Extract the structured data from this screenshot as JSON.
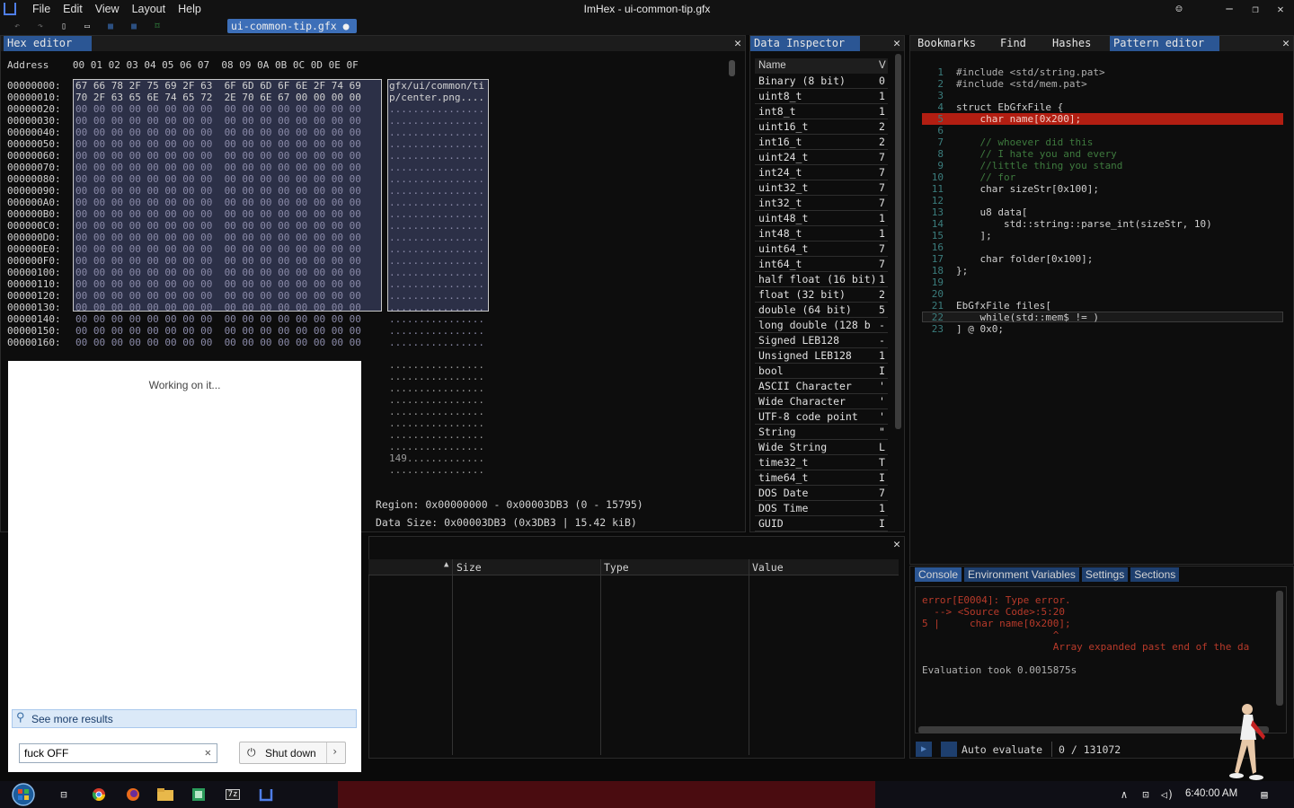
{
  "window": {
    "title": "ImHex - ui-common-tip.gfx",
    "menu": [
      "File",
      "Edit",
      "View",
      "Layout",
      "Help"
    ],
    "file_tab": "ui-common-tip.gfx ●"
  },
  "hex_editor": {
    "tab": "Hex editor",
    "header": "Address    00 01 02 03 04 05 06 07  08 09 0A 0B 0C 0D 0E 0F",
    "rows": [
      {
        "addr": "00000000:",
        "bytes": "67 66 78 2F 75 69 2F 63  6F 6D 6D 6F 6E 2F 74 69",
        "ascii": "gfx/ui/common/ti"
      },
      {
        "addr": "00000010:",
        "bytes": "70 2F 63 65 6E 74 65 72  2E 70 6E 67 00 00 00 00",
        "ascii": "p/center.png...."
      },
      {
        "addr": "00000020:",
        "bytes": "00 00 00 00 00 00 00 00  00 00 00 00 00 00 00 00",
        "ascii": "................"
      },
      {
        "addr": "00000030:",
        "bytes": "00 00 00 00 00 00 00 00  00 00 00 00 00 00 00 00",
        "ascii": "................"
      },
      {
        "addr": "00000040:",
        "bytes": "00 00 00 00 00 00 00 00  00 00 00 00 00 00 00 00",
        "ascii": "................"
      },
      {
        "addr": "00000050:",
        "bytes": "00 00 00 00 00 00 00 00  00 00 00 00 00 00 00 00",
        "ascii": "................"
      },
      {
        "addr": "00000060:",
        "bytes": "00 00 00 00 00 00 00 00  00 00 00 00 00 00 00 00",
        "ascii": "................"
      },
      {
        "addr": "00000070:",
        "bytes": "00 00 00 00 00 00 00 00  00 00 00 00 00 00 00 00",
        "ascii": "................"
      },
      {
        "addr": "00000080:",
        "bytes": "00 00 00 00 00 00 00 00  00 00 00 00 00 00 00 00",
        "ascii": "................"
      },
      {
        "addr": "00000090:",
        "bytes": "00 00 00 00 00 00 00 00  00 00 00 00 00 00 00 00",
        "ascii": "................"
      },
      {
        "addr": "000000A0:",
        "bytes": "00 00 00 00 00 00 00 00  00 00 00 00 00 00 00 00",
        "ascii": "................"
      },
      {
        "addr": "000000B0:",
        "bytes": "00 00 00 00 00 00 00 00  00 00 00 00 00 00 00 00",
        "ascii": "................"
      },
      {
        "addr": "000000C0:",
        "bytes": "00 00 00 00 00 00 00 00  00 00 00 00 00 00 00 00",
        "ascii": "................"
      },
      {
        "addr": "000000D0:",
        "bytes": "00 00 00 00 00 00 00 00  00 00 00 00 00 00 00 00",
        "ascii": "................"
      },
      {
        "addr": "000000E0:",
        "bytes": "00 00 00 00 00 00 00 00  00 00 00 00 00 00 00 00",
        "ascii": "................"
      },
      {
        "addr": "000000F0:",
        "bytes": "00 00 00 00 00 00 00 00  00 00 00 00 00 00 00 00",
        "ascii": "................"
      },
      {
        "addr": "00000100:",
        "bytes": "00 00 00 00 00 00 00 00  00 00 00 00 00 00 00 00",
        "ascii": "................"
      },
      {
        "addr": "00000110:",
        "bytes": "00 00 00 00 00 00 00 00  00 00 00 00 00 00 00 00",
        "ascii": "................"
      },
      {
        "addr": "00000120:",
        "bytes": "00 00 00 00 00 00 00 00  00 00 00 00 00 00 00 00",
        "ascii": "................"
      },
      {
        "addr": "00000130:",
        "bytes": "00 00 00 00 00 00 00 00  00 00 00 00 00 00 00 00",
        "ascii": "................"
      },
      {
        "addr": "00000140:",
        "bytes": "00 00 00 00 00 00 00 00  00 00 00 00 00 00 00 00",
        "ascii": "................"
      },
      {
        "addr": "00000150:",
        "bytes": "00 00 00 00 00 00 00 00  00 00 00 00 00 00 00 00",
        "ascii": "................"
      },
      {
        "addr": "00000160:",
        "bytes": "00 00 00 00 00 00 00 00  00 00 00 00 00 00 00 00",
        "ascii": "................"
      }
    ],
    "lower_ascii": [
      "................",
      "................",
      "................",
      "................",
      "................",
      "................",
      "................",
      "................",
      "149.............",
      "................"
    ],
    "region": "Region: 0x00000000 - 0x00003DB3 (0 - 15795)",
    "data_size": "Data Size: 0x00003DB3 (0x3DB3 | 15.42 kiB)"
  },
  "data_inspector": {
    "tab": "Data Inspector",
    "col_name": "Name",
    "col_value": "V",
    "rows": [
      {
        "n": "Binary (8 bit)",
        "v": "0"
      },
      {
        "n": "uint8_t",
        "v": "1"
      },
      {
        "n": "int8_t",
        "v": "1"
      },
      {
        "n": "uint16_t",
        "v": "2"
      },
      {
        "n": "int16_t",
        "v": "2"
      },
      {
        "n": "uint24_t",
        "v": "7"
      },
      {
        "n": "int24_t",
        "v": "7"
      },
      {
        "n": "uint32_t",
        "v": "7"
      },
      {
        "n": "int32_t",
        "v": "7"
      },
      {
        "n": "uint48_t",
        "v": "1"
      },
      {
        "n": "int48_t",
        "v": "1"
      },
      {
        "n": "uint64_t",
        "v": "7"
      },
      {
        "n": "int64_t",
        "v": "7"
      },
      {
        "n": "half float (16 bit)",
        "v": "1"
      },
      {
        "n": "float (32 bit)",
        "v": "2"
      },
      {
        "n": "double (64 bit)",
        "v": "5"
      },
      {
        "n": "long double (128 b",
        "v": "-"
      },
      {
        "n": "Signed LEB128",
        "v": "-"
      },
      {
        "n": "Unsigned LEB128",
        "v": "1"
      },
      {
        "n": "bool",
        "v": "I"
      },
      {
        "n": "ASCII Character",
        "v": "'"
      },
      {
        "n": "Wide Character",
        "v": "'"
      },
      {
        "n": "UTF-8 code point",
        "v": "'"
      },
      {
        "n": "String",
        "v": "\""
      },
      {
        "n": "Wide String",
        "v": "L"
      },
      {
        "n": "time32_t",
        "v": "T"
      },
      {
        "n": "time64_t",
        "v": "I"
      },
      {
        "n": "DOS Date",
        "v": "7"
      },
      {
        "n": "DOS Time",
        "v": "1"
      },
      {
        "n": "GUID",
        "v": "I"
      }
    ]
  },
  "pattern_data": {
    "cols": [
      "Size",
      "Type",
      "Value"
    ]
  },
  "right_tabs": [
    "Bookmarks",
    "Find",
    "Hashes",
    "Pattern editor"
  ],
  "code_lines": [
    "#include <std/string.pat>",
    "#include <std/mem.pat>",
    "",
    "struct EbGfxFile {",
    "    char name[0x200];",
    "",
    "    // whoever did this",
    "    // I hate you and every",
    "    //little thing you stand",
    "    // for",
    "    char sizeStr[0x100];",
    "",
    "    u8 data[",
    "        std::string::parse_int(sizeStr, 10)",
    "    ];",
    "",
    "    char folder[0x100];",
    "};",
    "",
    "",
    "EbGfxFile files[",
    "    while(std::mem$ != )",
    "] @ 0x0;"
  ],
  "console_tabs": [
    "Console",
    "Environment Variables",
    "Settings",
    "Sections"
  ],
  "console_lines": [
    "error[E0004]: Type error.",
    "  --> <Source Code>:5:20",
    "5 |     char name[0x200];",
    "                      ^",
    "                      Array expanded past end of the da",
    "",
    "Evaluation took 0.0015875s"
  ],
  "footer": {
    "auto_eval": "Auto evaluate",
    "counter": "0 / 131072"
  },
  "search": {
    "working": "Working on it...",
    "see_more": "See more results",
    "query": "fuck OFF",
    "shutdown": "Shut down"
  },
  "taskbar": {
    "time": "6:40:00 AM"
  }
}
